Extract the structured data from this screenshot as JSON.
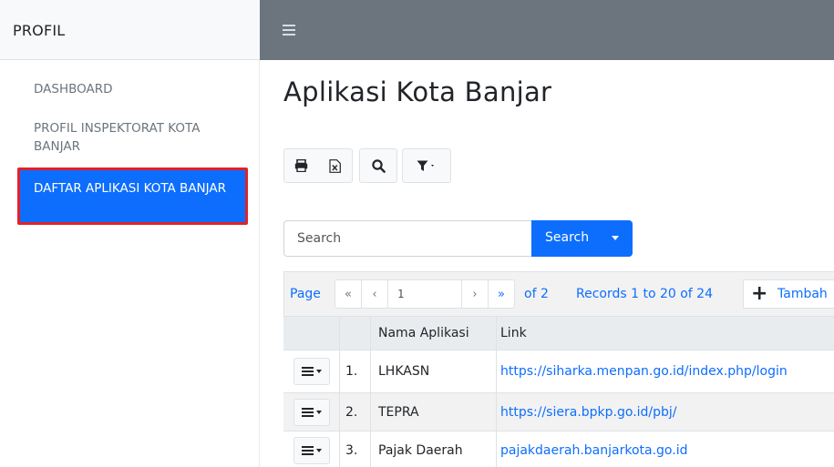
{
  "sidebar": {
    "brand": "PROFIL",
    "items": [
      {
        "label": "DASHBOARD"
      },
      {
        "label": "PROFIL INSPEKTORAT KOTA BANJAR"
      },
      {
        "label": "DAFTAR APLIKASI KOTA BANJAR",
        "active": true
      }
    ]
  },
  "topbar": {
    "menu_icon": "hamburger-icon"
  },
  "main": {
    "title": "Aplikasi Kota Banjar",
    "toolbar": {
      "icons": [
        "print-icon",
        "excel-export-icon",
        "search-icon",
        "filter-icon"
      ]
    },
    "search": {
      "placeholder": "Search",
      "button_label": "Search"
    },
    "pager": {
      "page_label": "Page",
      "current_page": "1",
      "of_label": "of 2",
      "records_label": "Records 1 to 20 of 24",
      "add_label": "Tambah"
    },
    "table": {
      "columns": [
        "",
        "",
        "Nama Aplikasi",
        "Link"
      ],
      "rows": [
        {
          "no": "1.",
          "nama": "LHKASN",
          "link": "https://siharka.menpan.go.id/index.php/login"
        },
        {
          "no": "2.",
          "nama": "TEPRA",
          "link": "https://siera.bpkp.go.id/pbj/"
        },
        {
          "no": "3.",
          "nama": "Pajak Daerah",
          "link": "pajakdaerah.banjarkota.go.id"
        }
      ]
    }
  },
  "colors": {
    "primary": "#0d6efd",
    "topbar": "#6c757d",
    "active_border": "#e0222a"
  }
}
